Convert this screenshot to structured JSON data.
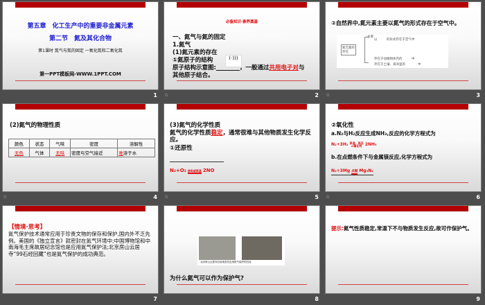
{
  "slides": [
    {
      "num": "1",
      "chapter": "第五章　化工生产中的重要非金属元素",
      "section": "第二节　氮及其化合物",
      "lesson": "第1课时 氮气与氮的固定 一氧化氮和二氧化氮",
      "site": "第一PPT模板网-WWW.1PPT.COM"
    },
    {
      "num": "2",
      "banner": "必备知识·素养奠基",
      "l1": "一、氮气与氮的固定",
      "l2": "1.氮气",
      "l3": "(1)氮元素的存在",
      "l4": "①氮原子的结构",
      "l5a": "原子结构示意图:",
      "l5b": "，一般通过",
      "l5ans": "共用电子对",
      "l5c": "与",
      "l6": "其他原子结合。"
    },
    {
      "num": "3",
      "title": "②自然界中,氮元素主要以氮气的形式存在于空气中。",
      "box": "氮元素的存在",
      "main": "主要",
      "r1": "以　　　的形式存在于空气中",
      "r2": "存在于动植物体内的　　　中",
      "r3": "存在于土壤、海洋里的　　　　中"
    },
    {
      "num": "4",
      "title": "(2)氮气的物理性质",
      "headers": [
        "颜色",
        "状态",
        "气味",
        "密度",
        "溶解性"
      ],
      "row": [
        "无色",
        "气体",
        "无味",
        "密度与空气接近",
        "难",
        "溶于水"
      ]
    },
    {
      "num": "5",
      "l1": "(3)氮气的化学性质",
      "l2a": "氮气的化学性质",
      "l2ans": "稳定",
      "l2b": "，通常很难与其他物质发生化学反应。",
      "l3": "①还原性",
      "eq_l": "N₂+O₂",
      "eq_cond": "放电或高温",
      "eq_r": "2NO"
    },
    {
      "num": "6",
      "l1": "②氧化性",
      "l2": "a.N₂与H₂反应生成NH₃,反应的化学方程式为",
      "eq1_l": "N₂+3H₂",
      "eq1_top": "高温、高压",
      "eq1_bot": "催化剂",
      "eq1_r": "2NH₃",
      "l3": "b.在点燃条件下与金属镁反应,化学方程式为",
      "eq2_l": "N₂+3Mg",
      "eq2_cond": "点燃",
      "eq2_r": "Mg₃N₂"
    },
    {
      "num": "7",
      "head": "【情境·思考】",
      "body": "氮气保护技术通常应用于珍贵文物的保存和保护,国内外不乏先例。美国的《独立宣言》就密封在氮气环境中;中国博物馆和中南海毛主席故居纪念馆也是应用氮气保护法;北京房山云居寺“99石经回藏”也是氮气保护的成功典范。"
    },
    {
      "num": "8",
      "caption": "北京房山云居寺石经地宫充应用氮气保护的石经",
      "question": "为什么氮气可以作为保护气?"
    },
    {
      "num": "9",
      "hint": "提示:",
      "body": "氮气性质稳定,常温下不与物质发生反应,故可作保护气。"
    }
  ]
}
